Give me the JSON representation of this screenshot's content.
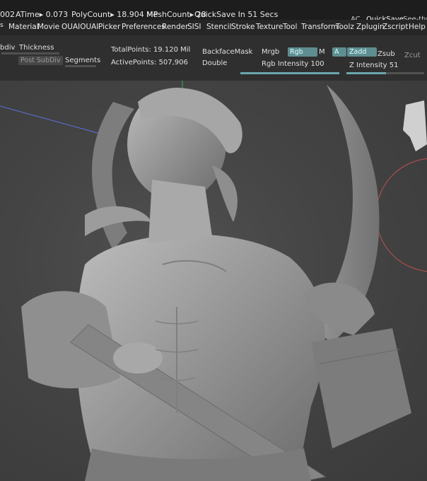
{
  "status_bar": {
    "free_mem": "002",
    "atime": "ATime▸ 0.073",
    "polycount": "PolyCount▸ 18.904 MP",
    "meshcount": "MeshCount▸ 28",
    "quicksave_timer": "QuickSave In 51 Secs",
    "ac_label": "AC",
    "quicksave_button": "QuickSave",
    "see_through": "See-throug"
  },
  "menu": {
    "items": [
      "Material",
      "Movie",
      "OUAIOUAI",
      "Picker",
      "Preferences",
      "Render",
      "SISI",
      "Stencil",
      "Stroke",
      "Texture",
      "Tool",
      "Transform",
      "Toolz",
      "Zplugin",
      "Zscript",
      "Help"
    ]
  },
  "tool_row": {
    "sdiv_label": "bdiv",
    "thickness_label": "Thickness",
    "post_subdiv_label": "Post SubDiv",
    "segments_label": "Segments",
    "total_points": "TotalPoints: 19.120 Mil",
    "active_points": "ActivePoints: 507,906",
    "backface_mask": "BackfaceMask",
    "double": "Double",
    "mrgb": "Mrgb",
    "rgb": "Rgb",
    "m": "M",
    "a": "A",
    "zadd": "Zadd",
    "zsub": "Zsub",
    "zcut": "Zcut",
    "rgb_intensity": "Rgb Intensity 100",
    "z_intensity": "Z Intensity 51",
    "rgb_intensity_value": 100,
    "z_intensity_value": 51
  },
  "colors": {
    "active_button": "#5e8e90",
    "slider_fill": "#6aa7ad",
    "model_gray": "#a0a0a0",
    "axis_red": "#c05050",
    "axis_blue": "#5a6fd8",
    "axis_green": "#3fb04a"
  }
}
